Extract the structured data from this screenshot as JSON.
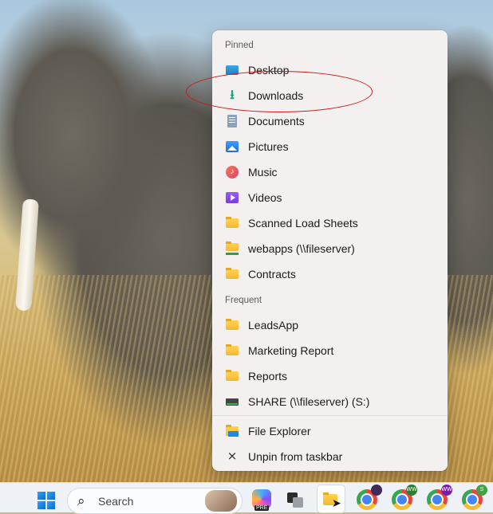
{
  "jumplist": {
    "pinned_header": "Pinned",
    "pinned": [
      {
        "label": "Desktop",
        "icon": "desktop-folder-icon"
      },
      {
        "label": "Downloads",
        "icon": "download-arrow-icon"
      },
      {
        "label": "Documents",
        "icon": "documents-icon"
      },
      {
        "label": "Pictures",
        "icon": "pictures-icon"
      },
      {
        "label": "Music",
        "icon": "music-icon"
      },
      {
        "label": "Videos",
        "icon": "videos-icon"
      },
      {
        "label": "Scanned Load Sheets",
        "icon": "folder-icon"
      },
      {
        "label": "webapps (\\\\fileserver)",
        "icon": "network-folder-icon"
      },
      {
        "label": "Contracts",
        "icon": "folder-icon"
      }
    ],
    "frequent_header": "Frequent",
    "frequent": [
      {
        "label": "LeadsApp",
        "icon": "folder-icon"
      },
      {
        "label": "Marketing Report",
        "icon": "folder-icon"
      },
      {
        "label": "Reports",
        "icon": "folder-icon"
      },
      {
        "label": "SHARE (\\\\fileserver) (S:)",
        "icon": "network-drive-icon"
      }
    ],
    "tasks": [
      {
        "label": "File Explorer",
        "icon": "file-explorer-icon"
      },
      {
        "label": "Unpin from taskbar",
        "icon": "unpin-icon"
      }
    ]
  },
  "taskbar": {
    "search_placeholder": "Search",
    "copilot_badge": "PRE",
    "apps": [
      "start-icon",
      "copilot-icon",
      "task-view-icon",
      "file-explorer-icon",
      "chrome-icon",
      "chrome-icon",
      "chrome-icon",
      "chrome-icon"
    ],
    "chrome_badges": [
      "",
      "WW",
      "WW",
      "S"
    ]
  },
  "colors": {
    "annotation": "#d01919",
    "menu_bg": "#f3f0ef",
    "taskbar_bg": "#eef1f5"
  }
}
